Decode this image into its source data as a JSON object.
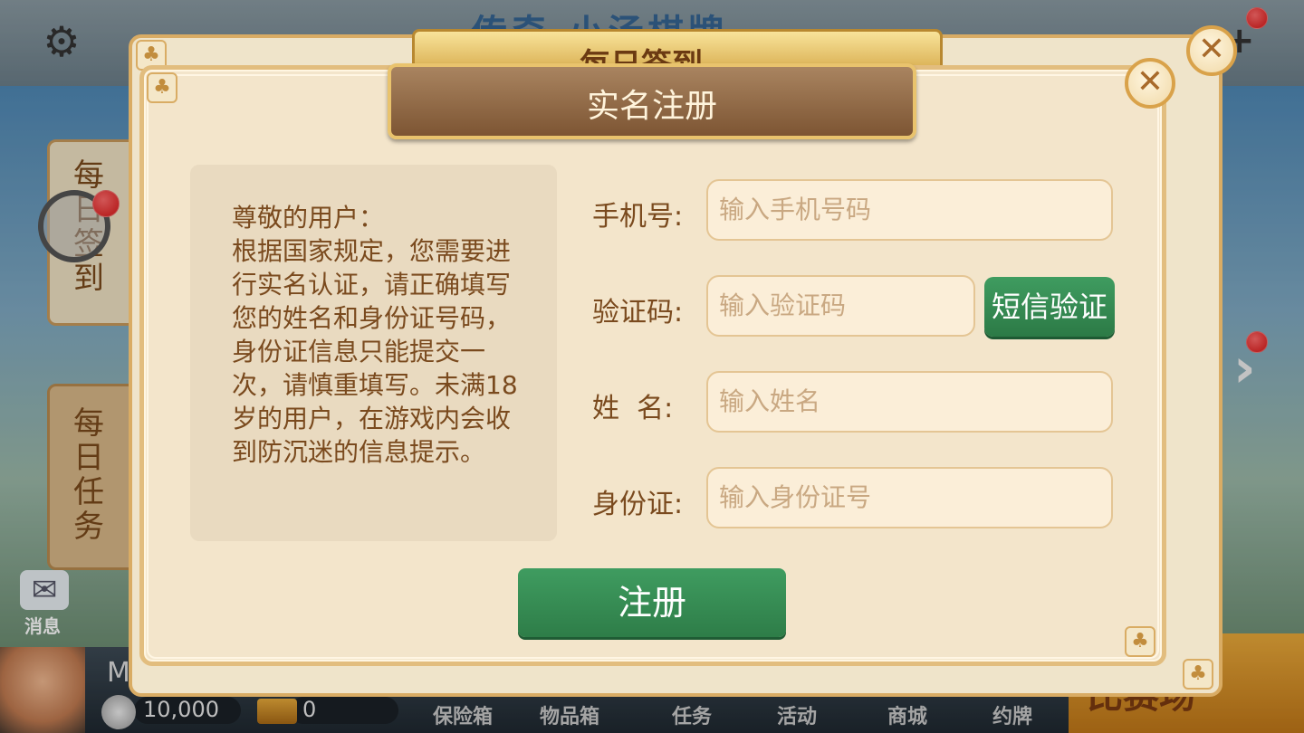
{
  "background": {
    "header_title": "传奇·小汤棋牌",
    "side_tabs": [
      {
        "label": "每日签到"
      },
      {
        "label": "每日任务"
      }
    ],
    "mail_label": "消息",
    "user_initial": "M",
    "coins": "10,000",
    "gold": "0",
    "nav": [
      "保险箱",
      "物品箱",
      "任务",
      "活动",
      "商城",
      "约牌"
    ],
    "match_label": "比赛场"
  },
  "back_dialog": {
    "title": "每日签到"
  },
  "dialog": {
    "title": "实名注册",
    "notice": "尊敬的用户：\n根据国家规定，您需要进行实名认证，请正确填写您的姓名和身份证号码，身份证信息只能提交一次，请慎重填写。未满18岁的用户，在游戏内会收到防沉迷的信息提示。",
    "fields": {
      "phone": {
        "label": "手机号:",
        "placeholder": "输入手机号码"
      },
      "code": {
        "label": "验证码:",
        "placeholder": "输入验证码"
      },
      "name": {
        "label": "姓  名:",
        "placeholder": "输入姓名"
      },
      "id": {
        "label": "身份证:",
        "placeholder": "输入身份证号"
      }
    },
    "sms_button": "短信验证",
    "register_button": "注册"
  },
  "icons": {
    "settings": "gear-icon",
    "close": "close-icon",
    "club": "club-icon",
    "mail": "mail-icon",
    "add": "plus-icon"
  },
  "colors": {
    "dialog_bg": "#f3e5cb",
    "title_banner": "#8c6440",
    "green_button": "#2e7d48",
    "text_brown": "#7a4a1e"
  }
}
